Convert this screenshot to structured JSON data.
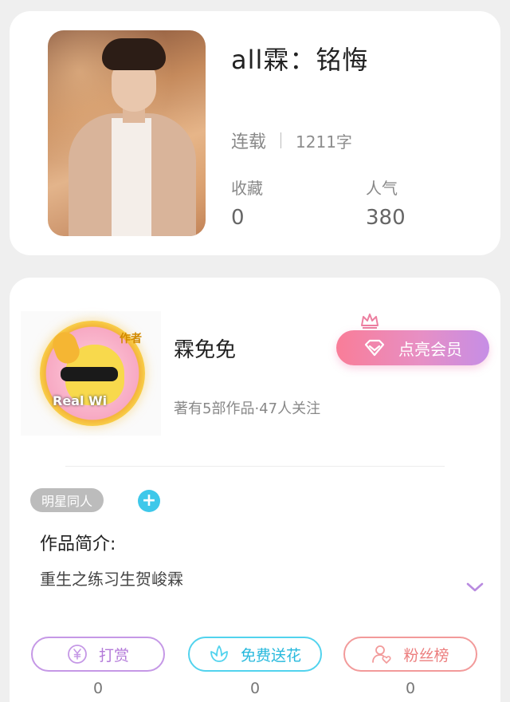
{
  "book": {
    "title": "all霖：铭悔",
    "status": "连载",
    "word_count": "1211字",
    "favorites_label": "收藏",
    "favorites_value": "0",
    "popularity_label": "人气",
    "popularity_value": "380"
  },
  "author": {
    "badge": "作者",
    "avatar_caption": "Real Wi",
    "name": "霖免免",
    "meta": "著有5部作品·47人关注",
    "vip_button_label": "点亮会员"
  },
  "tags": [
    "明星同人"
  ],
  "add_tag_label": "+",
  "intro": {
    "title": "作品简介:",
    "text": "重生之练习生贺峻霖"
  },
  "actions": {
    "tip": {
      "label": "打赏",
      "count": "0",
      "icon": "yen-icon"
    },
    "flower": {
      "label": "免费送花",
      "count": "0",
      "icon": "flower-icon"
    },
    "fans": {
      "label": "粉丝榜",
      "count": "0",
      "icon": "user-heart-icon"
    }
  },
  "colors": {
    "background": "#efefef",
    "card": "#ffffff",
    "vip_gradient_start": "#f97d98",
    "vip_gradient_end": "#c68ee6",
    "tip": "#b37ad9",
    "flower": "#27b9dd",
    "fans": "#ec7d7d",
    "tag": "#bcbcbc",
    "add_tag": "#3ec8ea"
  }
}
